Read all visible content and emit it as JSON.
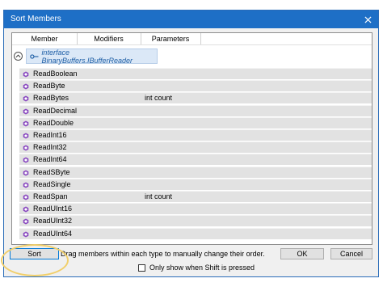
{
  "window": {
    "title": "Sort Members"
  },
  "columns": [
    "Member",
    "Modifiers",
    "Parameters"
  ],
  "group": {
    "label": "interface BinaryBuffers.IBufferReader",
    "icon": "interface-icon"
  },
  "members": [
    {
      "name": "ReadBoolean",
      "params": ""
    },
    {
      "name": "ReadByte",
      "params": ""
    },
    {
      "name": "ReadBytes",
      "params": "int count"
    },
    {
      "name": "ReadDecimal",
      "params": ""
    },
    {
      "name": "ReadDouble",
      "params": ""
    },
    {
      "name": "ReadInt16",
      "params": ""
    },
    {
      "name": "ReadInt32",
      "params": ""
    },
    {
      "name": "ReadInt64",
      "params": ""
    },
    {
      "name": "ReadSByte",
      "params": ""
    },
    {
      "name": "ReadSingle",
      "params": ""
    },
    {
      "name": "ReadSpan",
      "params": "int count"
    },
    {
      "name": "ReadUInt16",
      "params": ""
    },
    {
      "name": "ReadUInt32",
      "params": ""
    },
    {
      "name": "ReadUInt64",
      "params": ""
    }
  ],
  "buttons": {
    "sort": "Sort",
    "ok": "OK",
    "cancel": "Cancel"
  },
  "hint": "Drag members within each type to manually change their order.",
  "checkbox": {
    "label": "Only show when Shift is pressed",
    "checked": false
  },
  "colors": {
    "titlebar": "#1e6fc6",
    "member_icon": "#8a4ac0",
    "highlight": "#f1cf6a"
  }
}
